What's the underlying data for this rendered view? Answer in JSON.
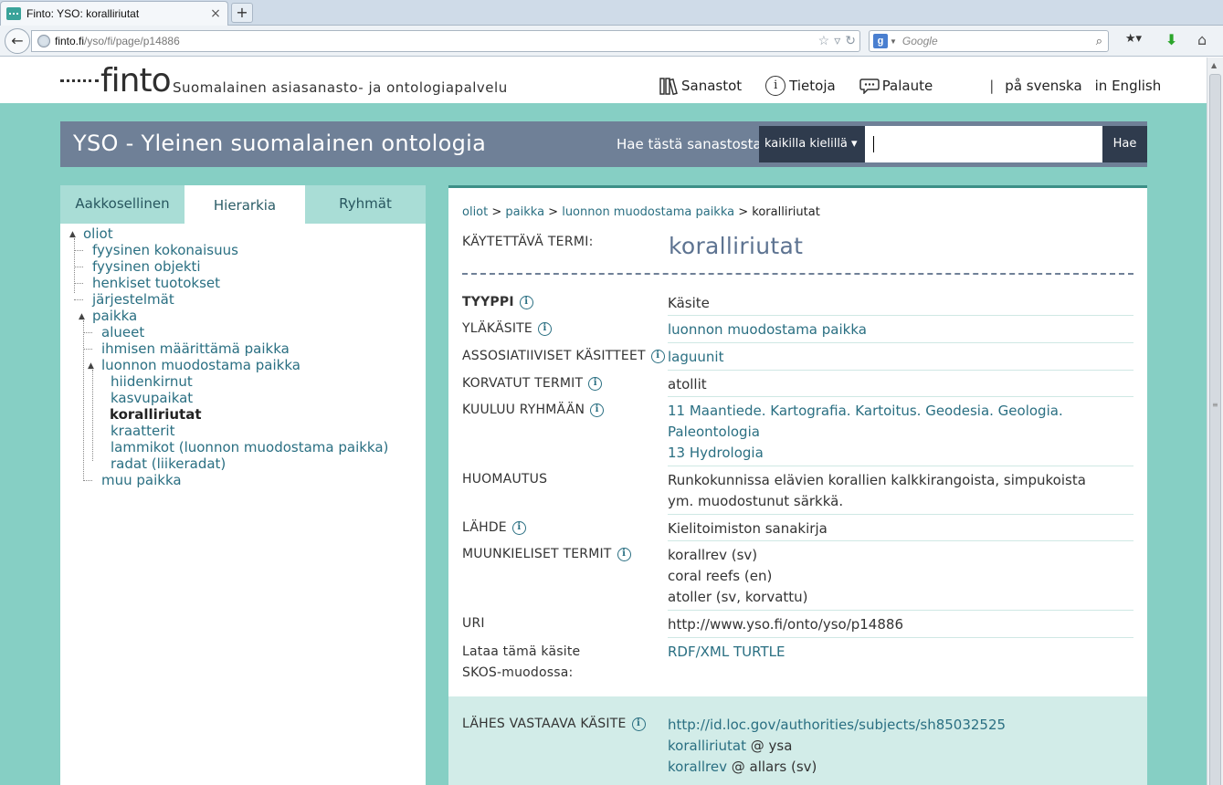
{
  "browser": {
    "tab_title": "Finto: YSO: koralliriutat",
    "tab_close": "×",
    "new_tab": "+",
    "back": "←",
    "url_host": "finto.fi",
    "url_path": "/yso/fi/page/p14886",
    "search_engine": "g",
    "search_placeholder": "Google"
  },
  "header": {
    "logo": "finto",
    "tagline": "Suomalainen asiasanasto- ja ontologiapalvelu",
    "nav": {
      "vocabularies": "Sanastot",
      "about": "Tietoja",
      "feedback": "Palaute",
      "separator": "|",
      "lang_sv": "på svenska",
      "lang_en": "in English"
    }
  },
  "vocab": {
    "title": "YSO - Yleinen suomalainen ontologia",
    "search_label": "Hae tästä sanastosta",
    "lang_select": "kaikilla kielillä ▾",
    "search_button": "Hae"
  },
  "sidebar": {
    "tabs": [
      "Aakkosellinen",
      "Hierarkia",
      "Ryhmät"
    ],
    "active_tab": "Hierarkia",
    "tree": [
      {
        "label": "oliot",
        "level": 0,
        "expanded": true
      },
      {
        "label": "fyysinen kokonaisuus",
        "level": 1
      },
      {
        "label": "fyysinen objekti",
        "level": 1
      },
      {
        "label": "henkiset tuotokset",
        "level": 1
      },
      {
        "label": "järjestelmät",
        "level": 1
      },
      {
        "label": "paikka",
        "level": 1,
        "expanded": true
      },
      {
        "label": "alueet",
        "level": 2
      },
      {
        "label": "ihmisen määrittämä paikka",
        "level": 2
      },
      {
        "label": "luonnon muodostama paikka",
        "level": 2,
        "expanded": true
      },
      {
        "label": "hiidenkirnut",
        "level": 3
      },
      {
        "label": "kasvupaikat",
        "level": 3
      },
      {
        "label": "koralliriutat",
        "level": 3,
        "current": true
      },
      {
        "label": "kraatterit",
        "level": 3
      },
      {
        "label": "lammikot (luonnon muodostama paikka)",
        "level": 3
      },
      {
        "label": "radat (liikeradat)",
        "level": 3
      },
      {
        "label": "muu paikka",
        "level": 2
      }
    ]
  },
  "concept": {
    "breadcrumb": [
      "oliot",
      "paikka",
      "luonnon muodostama paikka",
      "koralliriutat"
    ],
    "breadcrumb_sep": " > ",
    "pref_label_title": "KÄYTETTÄVÄ TERMI:",
    "pref_label": "koralliriutat",
    "info_icon": "i",
    "properties": {
      "type": {
        "label": "TYYPPI",
        "value": "Käsite"
      },
      "broader": {
        "label": "YLÄKÄSITE",
        "value": "luonnon muodostama paikka"
      },
      "related": {
        "label": "ASSOSIATIIVISET KÄSITTEET",
        "value": "laguunit"
      },
      "replaced": {
        "label": "KORVATUT TERMIT",
        "value": "atollit"
      },
      "groups": {
        "label": "KUULUU RYHMÄÄN",
        "values": [
          "11 Maantiede. Kartografia. Kartoitus. Geodesia. Geologia. Paleontologia",
          "13 Hydrologia"
        ]
      },
      "note": {
        "label": "HUOMAUTUS",
        "value": "Runkokunnissa elävien korallien kalkkirangoista, simpukoista ym. muodostunut särkkä."
      },
      "source": {
        "label": "LÄHDE",
        "value": "Kielitoimiston sanakirja"
      },
      "other_langs": {
        "label": "MUUNKIELISET TERMIT",
        "values": [
          "korallrev (sv)",
          "coral reefs (en)",
          "atoller (sv, korvattu)"
        ]
      },
      "uri": {
        "label": "URI",
        "value": "http://www.yso.fi/onto/yso/p14886"
      },
      "download": {
        "label_line1": "Lataa tämä käsite",
        "label_line2": "SKOS-muodossa:",
        "formats": "RDF/XML TURTLE"
      },
      "close_match": {
        "label": "LÄHES VASTAAVA KÄSITE",
        "links": [
          {
            "link": "http://id.loc.gov/authorities/subjects/sh85032525",
            "suffix": ""
          },
          {
            "link": "koralliriutat",
            "suffix": " @ ysa"
          },
          {
            "link": "korallrev",
            "suffix": " @ allars (sv)"
          }
        ]
      }
    }
  },
  "colors": {
    "page_bg": "#86cfc4",
    "vocab_bar": "#6f8097",
    "dark_btn": "#2f3b4d",
    "link": "#2a6f82",
    "pref_term": "#5d7391",
    "mapping_bg": "#d2ece8"
  }
}
